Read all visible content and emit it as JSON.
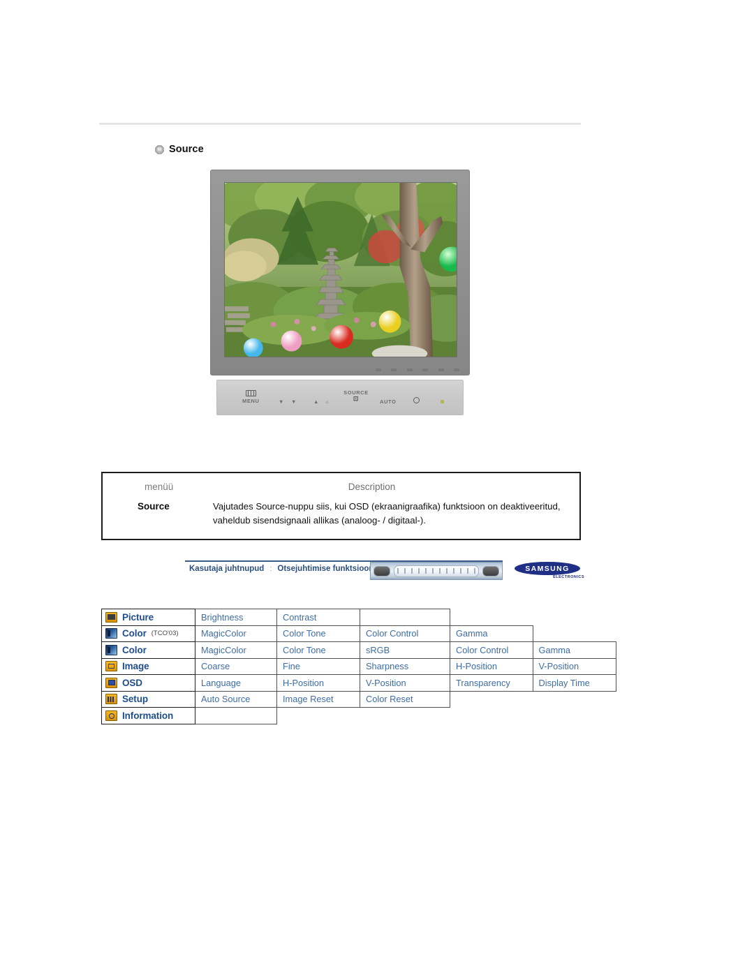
{
  "section": {
    "bullet_icon": "octagon-bullet-icon",
    "title": "Source"
  },
  "monitor": {
    "screen_alt": "garden-photo-with-stone-pagoda",
    "control_panel": {
      "menu_label": "MENU",
      "source_label": "SOURCE",
      "auto_label": "AUTO",
      "down_glyph": "▼",
      "up_glyph": "▲",
      "brightness_glyph": "☼",
      "enter_glyph": "⊡",
      "power_glyph": "⏻"
    }
  },
  "desc_table": {
    "header_menu": "menüü",
    "header_description": "Description",
    "rows": [
      {
        "menu": "Source",
        "description": "Vajutades Source-nuppu siis, kui OSD (ekraanigraafika) funktsioon on deaktiveeritud, vaheldub sisendsignaali allikas (analoog- / digitaal-)."
      }
    ]
  },
  "navbar": {
    "crumb1": "Kasutaja juhtnupud",
    "separator": ":",
    "crumb2": "Otsejuhtimise funktsioonid",
    "brand": "SAMSUNG",
    "brand_sub": "ELECTRONICS"
  },
  "menu_map": {
    "rows": [
      {
        "icon": "picture-icon",
        "icon_class": "mi-picture",
        "label": "Picture",
        "note": "",
        "items": [
          "Brightness",
          "Contrast"
        ]
      },
      {
        "icon": "color-icon",
        "icon_class": "mi-color",
        "label": "Color",
        "note": "(TCO'03)",
        "items": [
          "MagicColor",
          "Color Tone",
          "Color Control",
          "Gamma"
        ]
      },
      {
        "icon": "color-icon",
        "icon_class": "mi-color",
        "label": "Color",
        "note": "",
        "items": [
          "MagicColor",
          "Color Tone",
          "sRGB",
          "Color Control",
          "Gamma"
        ]
      },
      {
        "icon": "image-icon",
        "icon_class": "mi-image",
        "label": "Image",
        "note": "",
        "items": [
          "Coarse",
          "Fine",
          "Sharpness",
          "H-Position",
          "V-Position"
        ]
      },
      {
        "icon": "osd-icon",
        "icon_class": "mi-osd",
        "label": "OSD",
        "note": "",
        "items": [
          "Language",
          "H-Position",
          "V-Position",
          "Transparency",
          "Display Time"
        ]
      },
      {
        "icon": "setup-icon",
        "icon_class": "mi-setup",
        "label": "Setup",
        "note": "",
        "items": [
          "Auto Source",
          "Image Reset",
          "Color Reset"
        ]
      },
      {
        "icon": "information-icon",
        "icon_class": "mi-info",
        "label": "Information",
        "note": "",
        "items": []
      }
    ]
  },
  "colors": {
    "link_blue": "#3e6da6",
    "heading_blue": "#1f4e8c",
    "brand_navy": "#202f86",
    "icon_amber": "#f3b724",
    "border_black": "#1c1c1c"
  }
}
